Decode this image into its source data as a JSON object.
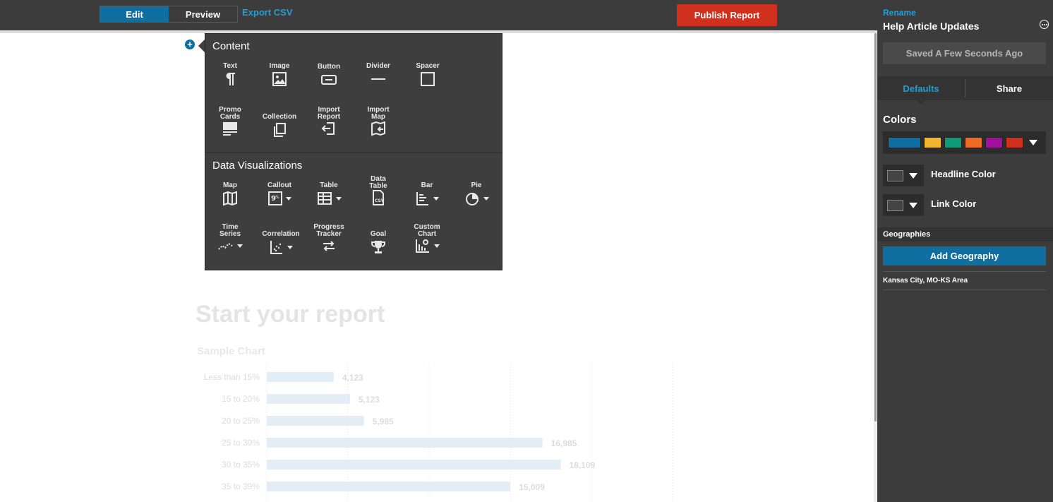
{
  "topbar": {
    "edit_label": "Edit",
    "preview_label": "Preview",
    "export_label": "Export CSV",
    "publish_label": "Publish Report"
  },
  "sidebar": {
    "rename_label": "Rename",
    "report_name": "Help Article Updates",
    "saved_status": "Saved A Few Seconds Ago",
    "tabs": [
      "Defaults",
      "Share"
    ],
    "colors_heading": "Colors",
    "palette": [
      "#0e6fa0",
      "#f3b52e",
      "#109b78",
      "#ef6a22",
      "#a50f9e",
      "#d0301e"
    ],
    "headline_color_label": "Headline Color",
    "link_color_label": "Link Color",
    "geographies_heading": "Geographies",
    "add_geography_label": "Add Geography",
    "geographies": [
      "Kansas City, MO-KS Area"
    ]
  },
  "menu": {
    "content_heading": "Content",
    "content_items": [
      {
        "label": "Text",
        "icon": "paragraph-icon"
      },
      {
        "label": "Image",
        "icon": "image-icon"
      },
      {
        "label": "Button",
        "icon": "button-icon"
      },
      {
        "label": "Divider",
        "icon": "divider-icon"
      },
      {
        "label": "Spacer",
        "icon": "spacer-icon"
      },
      {
        "label": "Promo Cards",
        "icon": "promo-cards-icon"
      },
      {
        "label": "Collection",
        "icon": "collection-icon"
      },
      {
        "label": "Import Report",
        "icon": "import-report-icon"
      },
      {
        "label": "Import Map",
        "icon": "import-map-icon"
      }
    ],
    "viz_heading": "Data Visualizations",
    "viz_items": [
      {
        "label": "Map",
        "icon": "map-icon"
      },
      {
        "label": "Callout",
        "icon": "callout-icon"
      },
      {
        "label": "Table",
        "icon": "table-icon"
      },
      {
        "label": "Data Table",
        "icon": "csv-file-icon"
      },
      {
        "label": "Bar",
        "icon": "bar-chart-icon"
      },
      {
        "label": "Pie",
        "icon": "pie-chart-icon"
      },
      {
        "label": "Time Series",
        "icon": "time-series-icon"
      },
      {
        "label": "Correlation",
        "icon": "scatter-icon"
      },
      {
        "label": "Progress Tracker",
        "icon": "progress-tracker-icon"
      },
      {
        "label": "Goal",
        "icon": "trophy-icon"
      },
      {
        "label": "Custom Chart",
        "icon": "custom-chart-icon"
      }
    ]
  },
  "report": {
    "title": "Start your report",
    "chart_title": "Sample Chart"
  },
  "chart_data": {
    "type": "bar",
    "title": "Sample Chart",
    "categories": [
      "Less than 15%",
      "15 to 20%",
      "20 to 25%",
      "25 to 30%",
      "30 to 35%",
      "35 to 39%"
    ],
    "values": [
      4123,
      5123,
      5985,
      16985,
      18109,
      15009
    ],
    "value_labels": [
      "4,123",
      "5,123",
      "5,985",
      "16,985",
      "18,109",
      "15,009"
    ],
    "xlim": [
      0,
      25000
    ],
    "grid": true
  }
}
